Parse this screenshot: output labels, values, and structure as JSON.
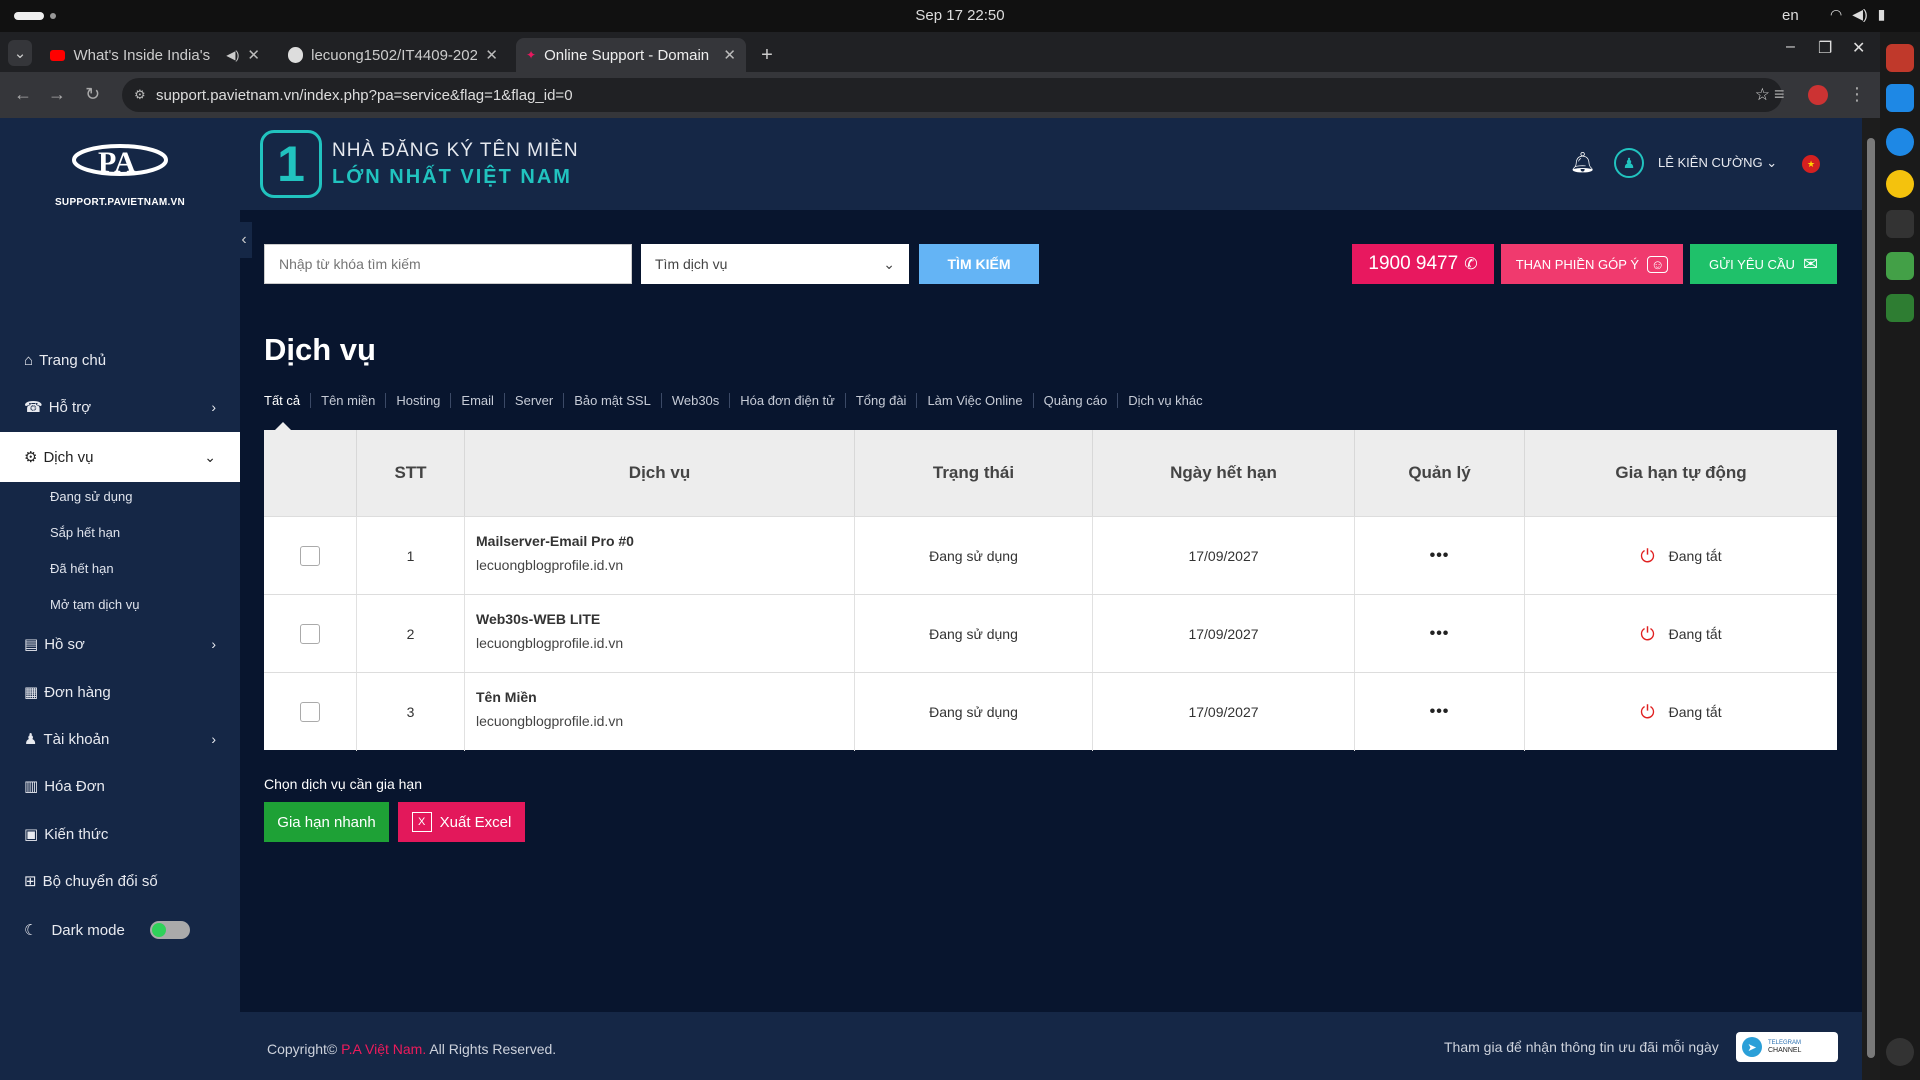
{
  "os": {
    "clock": "Sep 17  22:50",
    "lang": "en"
  },
  "browser": {
    "tabs": [
      {
        "label": "What's Inside India's",
        "icon": "youtube-icon"
      },
      {
        "label": "lecuong1502/IT4409-202",
        "icon": "github-icon"
      },
      {
        "label": "Online Support - Domain",
        "icon": "pa-icon"
      }
    ],
    "url": "support.pavietnam.vn/index.php?pa=service&flag=1&flag_id=0"
  },
  "logo": {
    "text": "SUPPORT.PAVIETNAM.VN"
  },
  "sidebar": {
    "items": [
      {
        "label": "Trang chủ",
        "icon": "home-icon"
      },
      {
        "label": "Hỗ trợ",
        "icon": "support-icon"
      },
      {
        "label": "Dịch vụ",
        "icon": "gear-icon"
      },
      {
        "label": "Hồ sơ",
        "icon": "document-icon"
      },
      {
        "label": "Đơn hàng",
        "icon": "order-icon"
      },
      {
        "label": "Tài khoản",
        "icon": "user-icon"
      },
      {
        "label": "Hóa Đơn",
        "icon": "invoice-icon"
      },
      {
        "label": "Kiến thức",
        "icon": "book-icon"
      },
      {
        "label": "Bộ chuyển đổi số",
        "icon": "sitemap-icon"
      }
    ],
    "sub_items": [
      "Đang sử dụng",
      "Sắp hết hạn",
      "Đã hết hạn",
      "Mở tạm dịch vụ"
    ],
    "dark_mode": "Dark mode"
  },
  "header": {
    "brand_number": "1",
    "brand_line1": "NHÀ ĐĂNG KÝ TÊN MIỀN",
    "brand_line2": "LỚN NHẤT VIỆT NAM",
    "user_name": "LÊ KIÊN CƯỜNG"
  },
  "search": {
    "placeholder": "Nhập từ khóa tìm kiếm",
    "select_value": "Tìm dịch vụ",
    "button": "TÌM KIẾM"
  },
  "actions": {
    "phone": "1900 9477",
    "complain": "THAN PHIỀN GÓP Ý",
    "request": "GỬI YÊU CẦU"
  },
  "page_title": "Dịch vụ",
  "filter_tabs": [
    "Tất cả",
    "Tên miền",
    "Hosting",
    "Email",
    "Server",
    "Bảo mật SSL",
    "Web30s",
    "Hóa đơn điện tử",
    "Tổng đài",
    "Làm Việc Online",
    "Quảng cáo",
    "Dịch vụ khác"
  ],
  "table": {
    "headers": [
      "",
      "STT",
      "Dịch vụ",
      "Trạng thái",
      "Ngày hết hạn",
      "Quản lý",
      "Gia hạn tự động"
    ],
    "rows": [
      {
        "stt": "1",
        "service": "Mailserver-Email Pro #0",
        "domain": "lecuongblogprofile.id.vn",
        "status": "Đang sử dụng",
        "expiry": "17/09/2027",
        "auto": "Đang tắt"
      },
      {
        "stt": "2",
        "service": "Web30s-WEB LITE",
        "domain": "lecuongblogprofile.id.vn",
        "status": "Đang sử dụng",
        "expiry": "17/09/2027",
        "auto": "Đang tắt"
      },
      {
        "stt": "3",
        "service": "Tên Miền",
        "domain": "lecuongblogprofile.id.vn",
        "status": "Đang sử dụng",
        "expiry": "17/09/2027",
        "auto": "Đang tắt"
      }
    ]
  },
  "renew": {
    "label": "Chọn dịch vụ cần gia hạn",
    "quick_button": "Gia hạn nhanh",
    "excel_button": "Xuất Excel"
  },
  "footer": {
    "copyright_prefix": "Copyright©",
    "company": "P.A Việt Nam.",
    "rights": "All Rights Reserved.",
    "telegram_text": "Tham gia để nhận thông tin ưu đãi mỗi ngày",
    "telegram_badge_1": "TELEGRAM",
    "telegram_badge_2": "CHANNEL"
  },
  "colors": {
    "accent": "#21c3bf",
    "pink": "#e8185f",
    "green": "#1fc16a",
    "bg": "#08152e",
    "sidebar": "#152746"
  }
}
